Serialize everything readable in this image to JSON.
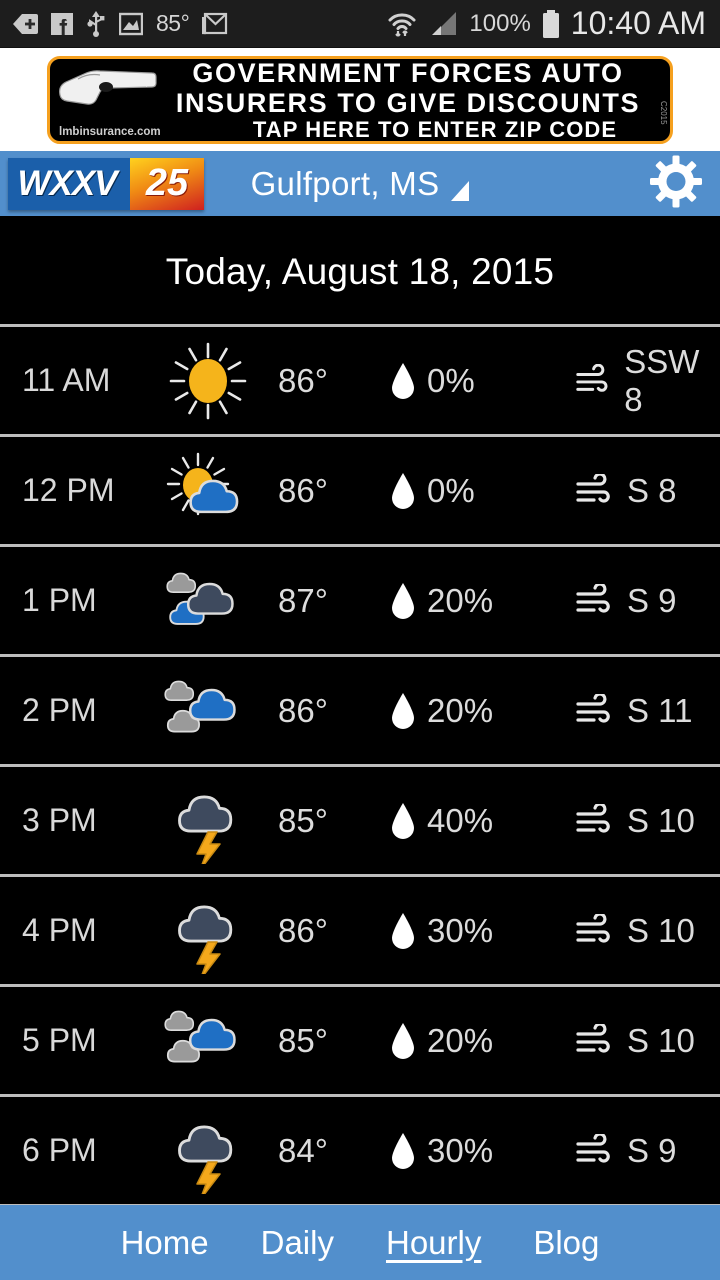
{
  "statusbar": {
    "icons": [
      "back-tag-icon",
      "facebook-icon",
      "usb-icon",
      "gallery-icon"
    ],
    "temperature": "85°",
    "mail_icon": "gmail-icon",
    "wifi_icon": "wifi-icon",
    "signal_icon": "cell-signal-icon",
    "battery_percent": "100%",
    "battery_icon": "battery-full-icon",
    "clock": "10:40 AM"
  },
  "ad": {
    "line1": "GOVERNMENT FORCES AUTO",
    "line2": "INSURERS TO GIVE DISCOUNTS",
    "line3": "TAP HERE TO ENTER ZIP CODE",
    "url": "lmbinsurance.com",
    "side_mark": "C2015",
    "border_color": "#f5a01e",
    "background_color": "#000000"
  },
  "header": {
    "logo_primary": "WXXV",
    "logo_secondary": "25",
    "location": "Gulfport, MS",
    "location_dropdown_icon": "triangle-dropdown-icon",
    "settings_icon": "gear-icon",
    "background_color": "#528fcc"
  },
  "date_header": {
    "label": "Today, August 18, 2015"
  },
  "hourly": {
    "rows": [
      {
        "time": "11 AM",
        "icon": "sunny-icon",
        "temp": "86°",
        "pop": "0%",
        "wind": "SSW 8"
      },
      {
        "time": "12 PM",
        "icon": "partly-sunny-icon",
        "temp": "86°",
        "pop": "0%",
        "wind": "S 8"
      },
      {
        "time": "1 PM",
        "icon": "mostly-cloudy-icon",
        "temp": "87°",
        "pop": "20%",
        "wind": "S 9"
      },
      {
        "time": "2 PM",
        "icon": "partly-cloudy-icon",
        "temp": "86°",
        "pop": "20%",
        "wind": "S 11"
      },
      {
        "time": "3 PM",
        "icon": "thunderstorm-icon",
        "temp": "85°",
        "pop": "40%",
        "wind": "S 10"
      },
      {
        "time": "4 PM",
        "icon": "thunderstorm-icon",
        "temp": "86°",
        "pop": "30%",
        "wind": "S 10"
      },
      {
        "time": "5 PM",
        "icon": "partly-cloudy-icon",
        "temp": "85°",
        "pop": "20%",
        "wind": "S 10"
      },
      {
        "time": "6 PM",
        "icon": "thunderstorm-icon",
        "temp": "84°",
        "pop": "30%",
        "wind": "S 9"
      }
    ],
    "pop_icon": "raindrop-icon",
    "wind_icon": "wind-icon"
  },
  "navbar": {
    "items": [
      {
        "label": "Home",
        "active": false
      },
      {
        "label": "Daily",
        "active": false
      },
      {
        "label": "Hourly",
        "active": true
      },
      {
        "label": "Blog",
        "active": false
      }
    ],
    "background_color": "#528fcc"
  }
}
